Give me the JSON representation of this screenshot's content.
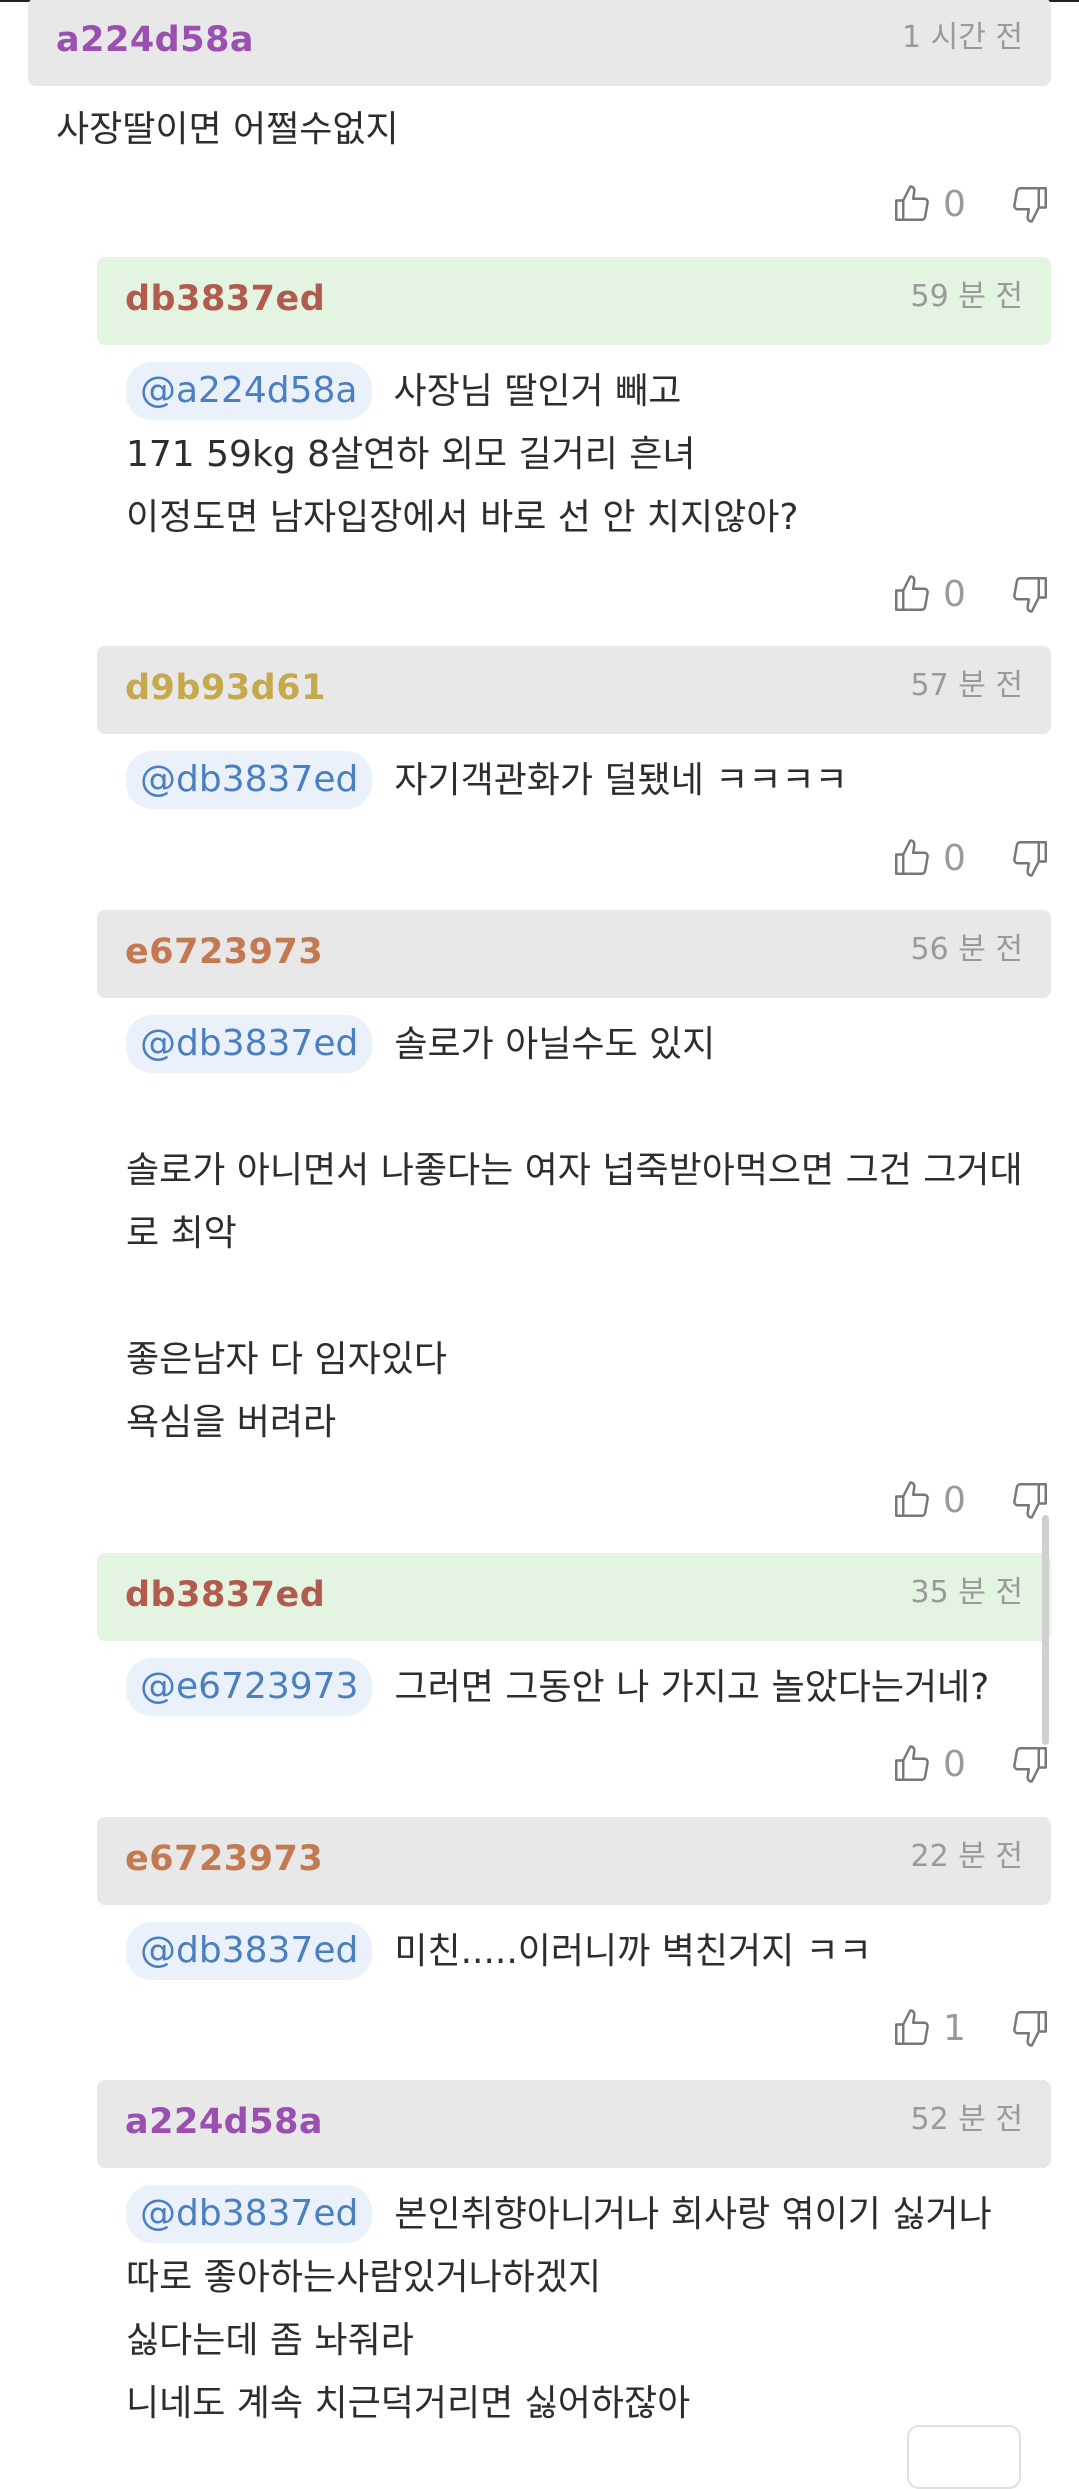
{
  "colors": {
    "author_a224d58a": "#9b4fb0",
    "author_db3837ed": "#b15b4e",
    "author_d9b93d61": "#c5a94d",
    "author_e6723973": "#c47a51",
    "mention_text": "#4a7fc1",
    "mention_bg": "#eaf1fb",
    "header_bg": "#e8e8e8",
    "header_bg_self": "#e3f4e0"
  },
  "comments": [
    {
      "author": "a224d58a",
      "time": "1 시간 전",
      "lines": [
        "사장딸이면 어쩔수없지"
      ],
      "likes": "0"
    },
    {
      "author": "db3837ed",
      "time": "59 분 전",
      "mention": "@a224d58a",
      "lines": [
        "사장님 딸인거 빼고",
        "171 59kg 8살연하 외모 길거리 흔녀",
        "이정도면 남자입장에서 바로 선 안 치지않아?"
      ],
      "likes": "0"
    },
    {
      "author": "d9b93d61",
      "time": "57 분 전",
      "mention": "@db3837ed",
      "lines": [
        "자기객관화가 덜됐네 ㅋㅋㅋㅋ"
      ],
      "likes": "0"
    },
    {
      "author": "e6723973",
      "time": "56 분 전",
      "mention": "@db3837ed",
      "lines": [
        "솔로가 아닐수도 있지",
        "",
        "솔로가 아니면서 나좋다는 여자 넙죽받아먹으면 그건 그거대",
        "로 최악",
        "",
        "좋은남자 다 임자있다",
        "욕심을 버려라"
      ],
      "likes": "0"
    },
    {
      "author": "db3837ed",
      "time": "35 분 전",
      "mention": "@e6723973",
      "lines": [
        "그러면 그동안 나 가지고 놀았다는거네?"
      ],
      "likes": "0"
    },
    {
      "author": "e6723973",
      "time": "22 분 전",
      "mention": "@db3837ed",
      "lines": [
        "미친.....이러니까 벽친거지 ㅋㅋ"
      ],
      "likes": "1"
    },
    {
      "author": "a224d58a",
      "time": "52 분 전",
      "mention": "@db3837ed",
      "lines": [
        "본인취향아니거나 회사랑 엮이기 싫거나",
        "따로 좋아하는사람있거나하겠지",
        "싫다는데 좀 놔줘라",
        "니네도 계속 치근덕거리면 싫어하잖아"
      ]
    }
  ]
}
